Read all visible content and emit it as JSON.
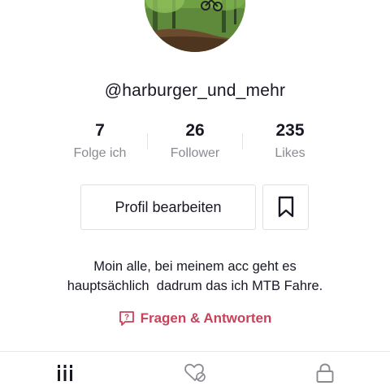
{
  "profile": {
    "username": "@harburger_und_mehr",
    "avatar": {
      "kind": "photo",
      "description": "forest-mtb-photo"
    }
  },
  "stats": [
    {
      "value": "7",
      "label": "Folge ich"
    },
    {
      "value": "26",
      "label": "Follower"
    },
    {
      "value": "235",
      "label": "Likes"
    }
  ],
  "actions": {
    "edit_profile_label": "Profil bearbeiten",
    "bookmark_icon": "bookmark-icon"
  },
  "bio": {
    "line1": "Moin alle, bei meinem acc geht es",
    "line2": "hauptsächlich  dadrum das ich MTB Fahre."
  },
  "qa": {
    "label": "Fragen & Antworten",
    "icon": "question-chat-icon",
    "color": "#c9415b"
  },
  "tabs": [
    {
      "icon": "grid-videos-icon",
      "active": true
    },
    {
      "icon": "liked-heart-icon",
      "active": false
    },
    {
      "icon": "lock-private-icon",
      "active": false
    }
  ]
}
